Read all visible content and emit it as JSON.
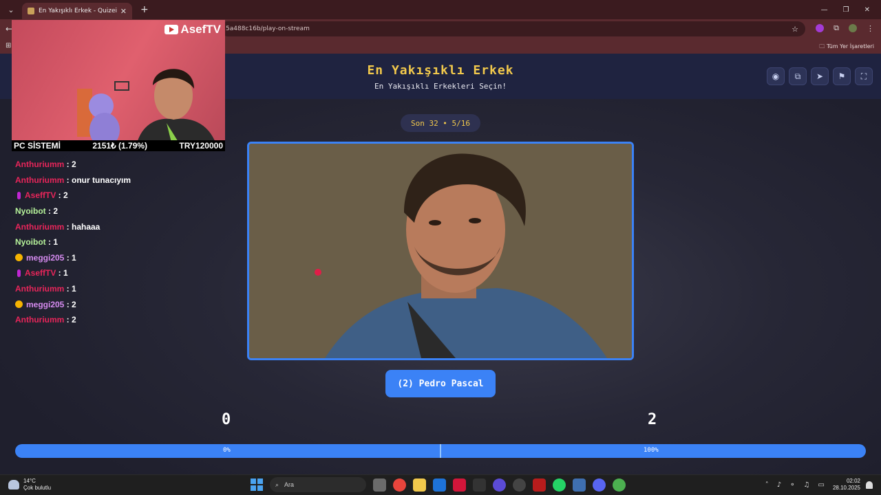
{
  "browser": {
    "tab_title": "En Yakışıklı Erkek - Quizei",
    "url": "5a488c16b/play-on-stream",
    "bookmarks_all": "Tüm Yer İşaretleri"
  },
  "quiz": {
    "title": "En Yakışıklı Erkek",
    "subtitle": "En Yakışıklı Erkekleri Seçin!",
    "round": "Son 32 • 5/16",
    "candidate_label": "(2) Pedro Pascal",
    "score_left": "0",
    "score_right": "2",
    "percent_left": "0%",
    "percent_right": "100%",
    "vote_fraction_right": 1.0
  },
  "stream": {
    "channel": "AsefTV",
    "info_left": "PC SİSTEMİ",
    "info_mid": "2151₺ (1.79%)",
    "info_right": "TRY120000"
  },
  "chat": [
    {
      "user": "Anthuriumm",
      "msg": "2",
      "color": "#e8255a",
      "badge": ""
    },
    {
      "user": "Anthuriumm",
      "msg": "onur tunacıyım",
      "color": "#e8255a",
      "badge": ""
    },
    {
      "user": "AseffTV",
      "msg": "2",
      "color": "#e8255a",
      "badge": "pin"
    },
    {
      "user": "Nyoibot",
      "msg": "2",
      "color": "#b6f29a",
      "badge": ""
    },
    {
      "user": "Anthuriumm",
      "msg": "hahaaa",
      "color": "#e8255a",
      "badge": ""
    },
    {
      "user": "Nyoibot",
      "msg": "1",
      "color": "#b6f29a",
      "badge": ""
    },
    {
      "user": "meggi205",
      "msg": "1",
      "color": "#d68bf0",
      "badge": "coin"
    },
    {
      "user": "AseffTV",
      "msg": "1",
      "color": "#e8255a",
      "badge": "pin"
    },
    {
      "user": "Anthuriumm",
      "msg": "1",
      "color": "#e8255a",
      "badge": ""
    },
    {
      "user": "meggi205",
      "msg": "2",
      "color": "#d68bf0",
      "badge": "coin"
    },
    {
      "user": "Anthuriumm",
      "msg": "2",
      "color": "#e8255a",
      "badge": ""
    }
  ],
  "taskbar": {
    "temp": "14°C",
    "weather": "Çok bulutlu",
    "search": "Ara",
    "time": "02:02",
    "date": "28.10.2025"
  },
  "colors": {
    "accent": "#3b82f6",
    "title": "#f2c94c"
  }
}
